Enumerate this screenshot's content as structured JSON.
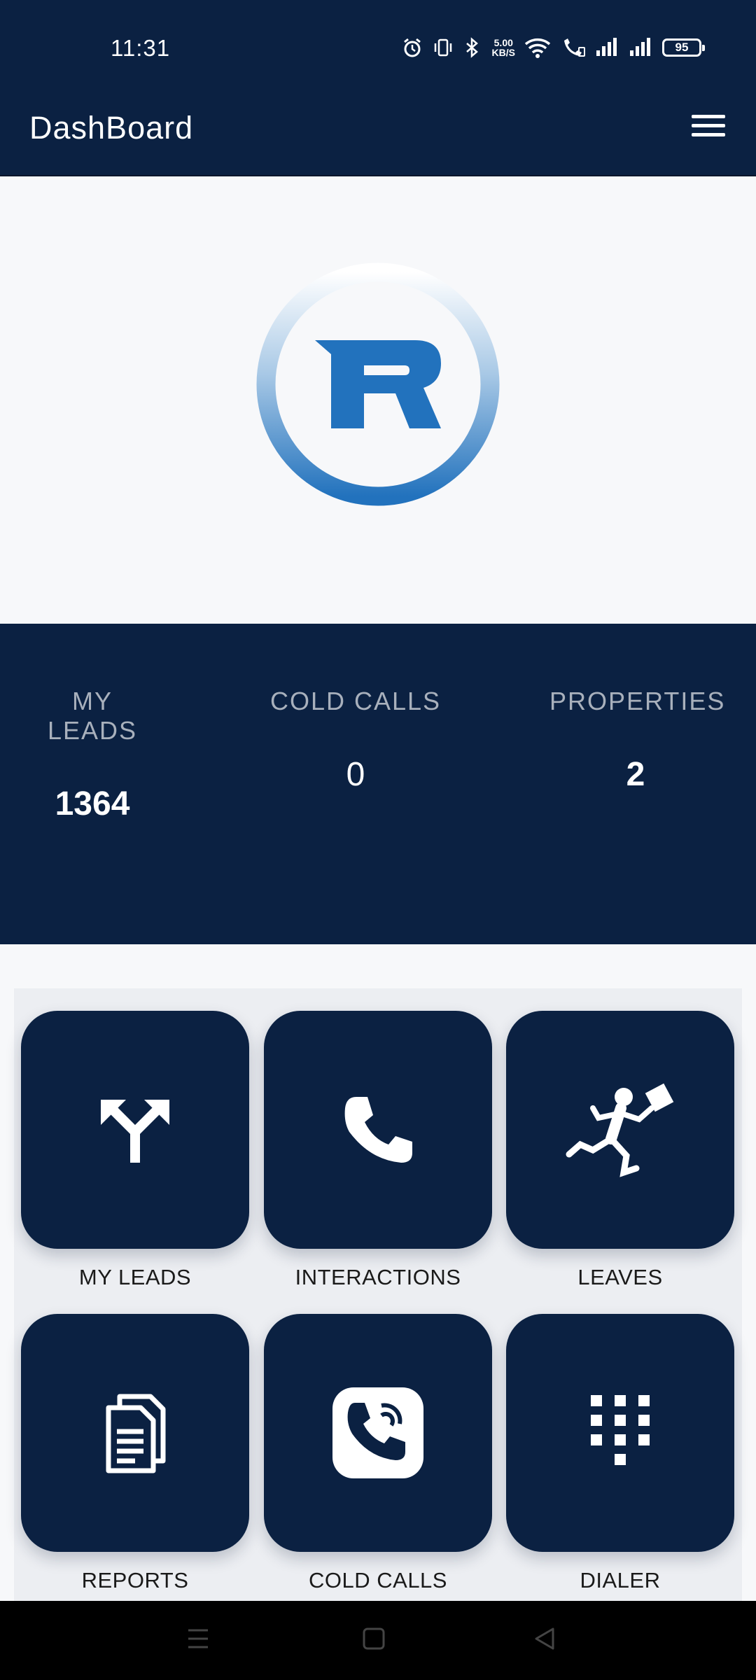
{
  "status_bar": {
    "time": "11:31",
    "net_speed_value": "5.00",
    "net_speed_unit": "KB/S",
    "battery": "95",
    "icons": [
      "alarm-icon",
      "vibrate-icon",
      "bluetooth-icon",
      "wifi-icon",
      "wifi-call-icon",
      "signal-icon",
      "signal-icon",
      "battery-icon"
    ]
  },
  "app_bar": {
    "title": "DashBoard",
    "menu_icon": "hamburger-menu-icon"
  },
  "logo": {
    "name": "brand-logo-r"
  },
  "stats": [
    {
      "label": "MY LEADS",
      "value": "1364"
    },
    {
      "label": "COLD CALLS",
      "value": "0"
    },
    {
      "label": "PROPERTIES",
      "value": "2"
    }
  ],
  "tiles": [
    {
      "label": "MY LEADS",
      "icon": "split-arrows-icon"
    },
    {
      "label": "INTERACTIONS",
      "icon": "phone-icon"
    },
    {
      "label": "LEAVES",
      "icon": "running-man-icon"
    },
    {
      "label": "REPORTS",
      "icon": "documents-icon"
    },
    {
      "label": "COLD CALLS",
      "icon": "phone-ringing-icon"
    },
    {
      "label": "DIALER",
      "icon": "dialpad-icon"
    }
  ],
  "nav_bar": {
    "buttons": [
      "recents-icon",
      "home-icon",
      "back-icon"
    ]
  },
  "colors": {
    "primary_navy": "#0b2142",
    "logo_blue": "#2272bd",
    "background": "#f7f8fa"
  }
}
